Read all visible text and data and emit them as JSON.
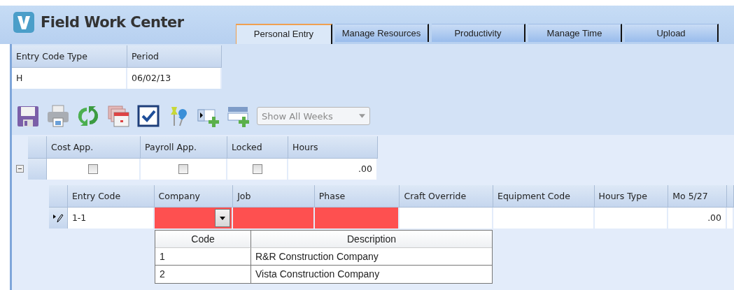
{
  "app": {
    "title": "Field Work Center"
  },
  "tabs": [
    {
      "label": "Personal Entry",
      "selected": true
    },
    {
      "label": "Manage Resources",
      "selected": false
    },
    {
      "label": "Productivity",
      "selected": false
    },
    {
      "label": "Manage Time",
      "selected": false
    },
    {
      "label": "Upload",
      "selected": false
    }
  ],
  "header_fields": {
    "columns": [
      "Entry Code Type",
      "Period"
    ],
    "values": [
      "H",
      "06/02/13"
    ]
  },
  "week_filter": {
    "value": "Show All Weeks",
    "disabled": true
  },
  "summary_grid": {
    "expanded": true,
    "columns": [
      "Cost App.",
      "Payroll App.",
      "Locked",
      "Hours"
    ],
    "rows": [
      {
        "cells": [
          {
            "kind": "checkbox",
            "checked": false
          },
          {
            "kind": "checkbox",
            "checked": false
          },
          {
            "kind": "checkbox",
            "checked": false
          },
          {
            "kind": "number",
            "value": ".00"
          }
        ]
      }
    ]
  },
  "detail_grid": {
    "columns": [
      "Entry Code",
      "Company",
      "Job",
      "Phase",
      "Craft Override",
      "Equipment Code",
      "Hours Type",
      "Mo 5/27"
    ],
    "rows": [
      {
        "editing": true,
        "cells": [
          {
            "kind": "text",
            "value": "1-1",
            "invalid": false
          },
          {
            "kind": "combo",
            "invalid": true
          },
          {
            "kind": "text",
            "invalid": true
          },
          {
            "kind": "text",
            "invalid": true
          },
          {
            "kind": "text",
            "invalid": false
          },
          {
            "kind": "text",
            "invalid": false
          },
          {
            "kind": "text",
            "invalid": false
          },
          {
            "kind": "number",
            "value": ".00",
            "invalid": false
          }
        ]
      }
    ]
  },
  "company_dropdown": {
    "columns": [
      "Code",
      "Description"
    ],
    "rows": [
      [
        "1",
        "R&R Construction Company"
      ],
      [
        "2",
        "Vista Construction Company"
      ]
    ]
  }
}
